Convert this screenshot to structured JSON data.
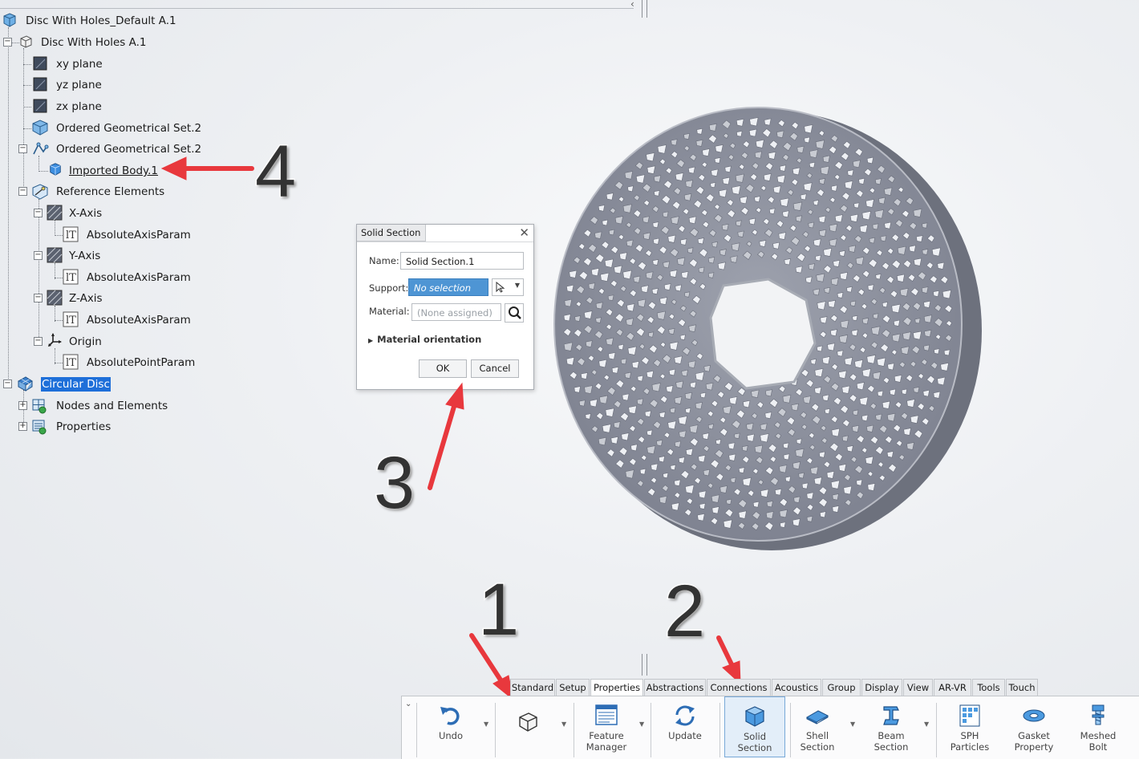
{
  "tree": [
    {
      "id": "root",
      "label": "Disc With Holes_Default A.1",
      "icon": "product-icon"
    },
    {
      "id": "part",
      "label": "Disc With Holes A.1",
      "icon": "part-icon"
    },
    {
      "id": "xy",
      "label": "xy plane",
      "icon": "plane-icon"
    },
    {
      "id": "yz",
      "label": "yz plane",
      "icon": "plane-icon"
    },
    {
      "id": "zx",
      "label": "zx plane",
      "icon": "plane-icon"
    },
    {
      "id": "ogs1",
      "label": "Ordered Geometrical Set.2",
      "icon": "geometrical-set-icon"
    },
    {
      "id": "ogs2",
      "label": "Ordered Geometrical Set.2",
      "icon": "geometrical-set-icon"
    },
    {
      "id": "body",
      "label": "Imported Body.1",
      "icon": "body-icon"
    },
    {
      "id": "ref",
      "label": "Reference Elements",
      "icon": "reference-elements-icon"
    },
    {
      "id": "xaxis",
      "label": "X-Axis",
      "icon": "axis-icon"
    },
    {
      "id": "xparam",
      "label": "AbsoluteAxisParam",
      "icon": "parameter-icon"
    },
    {
      "id": "yaxis",
      "label": "Y-Axis",
      "icon": "axis-icon"
    },
    {
      "id": "yparam",
      "label": "AbsoluteAxisParam",
      "icon": "parameter-icon"
    },
    {
      "id": "zaxis",
      "label": "Z-Axis",
      "icon": "axis-icon"
    },
    {
      "id": "zparam",
      "label": "AbsoluteAxisParam",
      "icon": "parameter-icon"
    },
    {
      "id": "origin",
      "label": "Origin",
      "icon": "origin-icon"
    },
    {
      "id": "oparam",
      "label": "AbsolutePointParam",
      "icon": "parameter-icon"
    },
    {
      "id": "fem",
      "label": "Circular Disc",
      "icon": "fem-rep-icon"
    },
    {
      "id": "nodes",
      "label": "Nodes and Elements",
      "icon": "nodes-elements-icon"
    },
    {
      "id": "props",
      "label": "Properties",
      "icon": "properties-icon"
    }
  ],
  "annotations": {
    "n1": "1",
    "n2": "2",
    "n3": "3",
    "n4": "4"
  },
  "dialog": {
    "title": "Solid Section",
    "name_label": "Name:",
    "name_value": "Solid Section.1",
    "support_label": "Support:",
    "support_value": "No selection",
    "material_label": "Material:",
    "material_value": "(None assigned)",
    "material_orientation": "Material orientation",
    "ok": "OK",
    "cancel": "Cancel"
  },
  "tabs": [
    "Standard",
    "Setup",
    "Properties",
    "Abstractions",
    "Connections",
    "Acoustics",
    "Group",
    "Display",
    "View",
    "AR-VR",
    "Tools",
    "Touch"
  ],
  "active_tab": "Properties",
  "toolbar": {
    "undo": "Undo",
    "feature_manager": [
      "Feature",
      "Manager"
    ],
    "update": "Update",
    "solid_section": [
      "Solid",
      "Section"
    ],
    "shell_section": [
      "Shell",
      "Section"
    ],
    "beam_section": [
      "Beam",
      "Section"
    ],
    "sph_particles": [
      "SPH",
      "Particles"
    ],
    "gasket_property": [
      "Gasket",
      "Property"
    ],
    "meshed_bolt": [
      "Meshed",
      "Bolt"
    ]
  },
  "colors": {
    "selection": "#1e6fd9",
    "arrow": "#e8383d",
    "disc": "#8e929f",
    "support_field": "#4e95d4"
  }
}
